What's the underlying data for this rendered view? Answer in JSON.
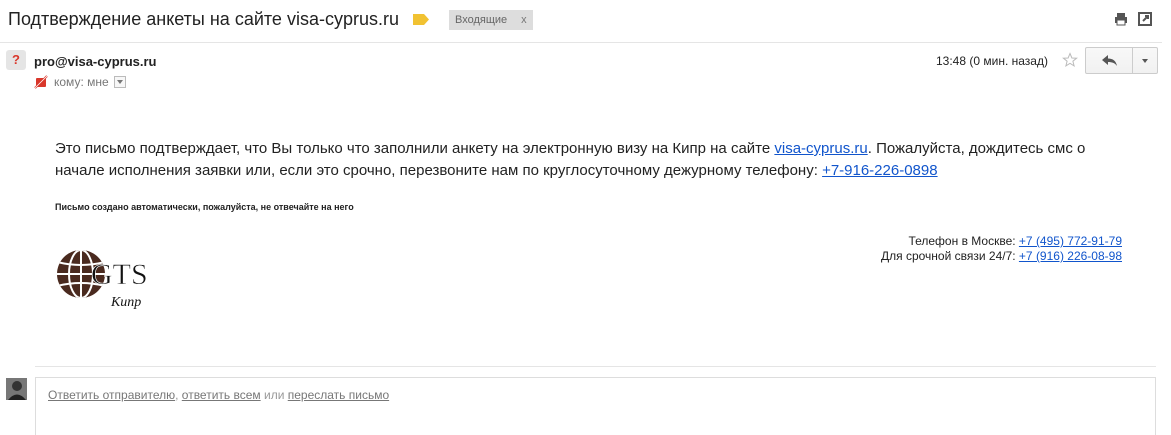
{
  "subject": "Подтверждение анкеты на сайте visa-cyprus.ru",
  "label_chip": {
    "text": "Входящие",
    "close": "x"
  },
  "toolbar_icons": {
    "print": "print-icon",
    "new_window": "new-window-icon"
  },
  "sender": {
    "avatar_glyph": "?",
    "email": "pro@visa-cyprus.ru"
  },
  "recipient": {
    "label": "кому: мне"
  },
  "timestamp": "13:48 (0 мин. назад)",
  "body": {
    "text_before_link": "Это письмо подтверждает, что Вы только что заполнили анкету на электронную визу на Кипр на сайте ",
    "site_link": "visa-cyprus.ru",
    "text_middle": ". Пожалуйста, дождитесь смс о начале исполнения заявки или, если это срочно, перезвоните нам по круглосуточному дежурному телефону: ",
    "phone_link": "+7-916-226-0898",
    "auto_note": "Письмо создано автоматически, пожалуйста, не отвечайте на него"
  },
  "logo": {
    "brand": "GTS",
    "sub": "Кипр"
  },
  "contacts": {
    "moscow_label": "Телефон в Москве: ",
    "moscow_phone": "+7 (495) 772-91-79",
    "urgent_label": "Для срочной связи 24/7: ",
    "urgent_phone": "+7 (916) 226-08-98"
  },
  "reply_bar": {
    "reply_sender": "Ответить отправителю",
    "comma": ", ",
    "reply_all": "ответить всем",
    "or": " или ",
    "forward": "переслать письмо"
  },
  "colors": {
    "link": "#1155cc",
    "label_tag": "#f1c232",
    "spam_icon": "#d9372b"
  }
}
